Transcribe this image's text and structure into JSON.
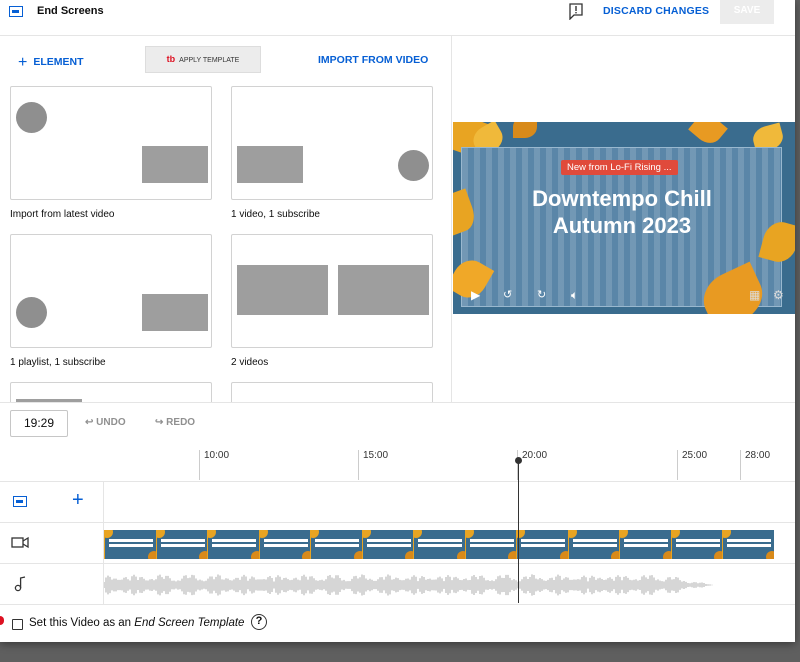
{
  "header": {
    "title": "End Screens",
    "discard_label": "DISCARD CHANGES",
    "save_label": "SAVE",
    "title_icon": "end-screen-icon",
    "feedback_icon": "feedback-icon"
  },
  "toolbar": {
    "element_label": "ELEMENT",
    "apply_template_label": "APPLY TEMPLATE",
    "apply_template_logo": "tb",
    "import_label": "IMPORT FROM VIDEO"
  },
  "templates": [
    {
      "label": "Import from latest video"
    },
    {
      "label": "1 video, 1 subscribe"
    },
    {
      "label": "1 playlist, 1 subscribe"
    },
    {
      "label": "2 videos"
    }
  ],
  "preview": {
    "badge": "New from Lo-Fi Rising ...",
    "title_line1": "Downtempo Chill",
    "title_line2": "Autumn 2023",
    "frame_title_line1": "Downtempo Chill",
    "frame_title_line2": "Autumn 2023"
  },
  "timeline": {
    "current_time": "19:29",
    "undo_label": "UNDO",
    "redo_label": "REDO",
    "ticks": [
      "10:00",
      "15:00",
      "20:00",
      "25:00",
      "28:00"
    ],
    "playhead_time": "19:29"
  },
  "footer": {
    "label_prefix": "Set this Video as an ",
    "label_emphasis": "End Screen Template",
    "checked": false
  },
  "colors": {
    "accent": "#065fd4",
    "thumb_bg": "#3a6c8e",
    "leaf": "#e8a422",
    "badge": "#e04a3b"
  }
}
